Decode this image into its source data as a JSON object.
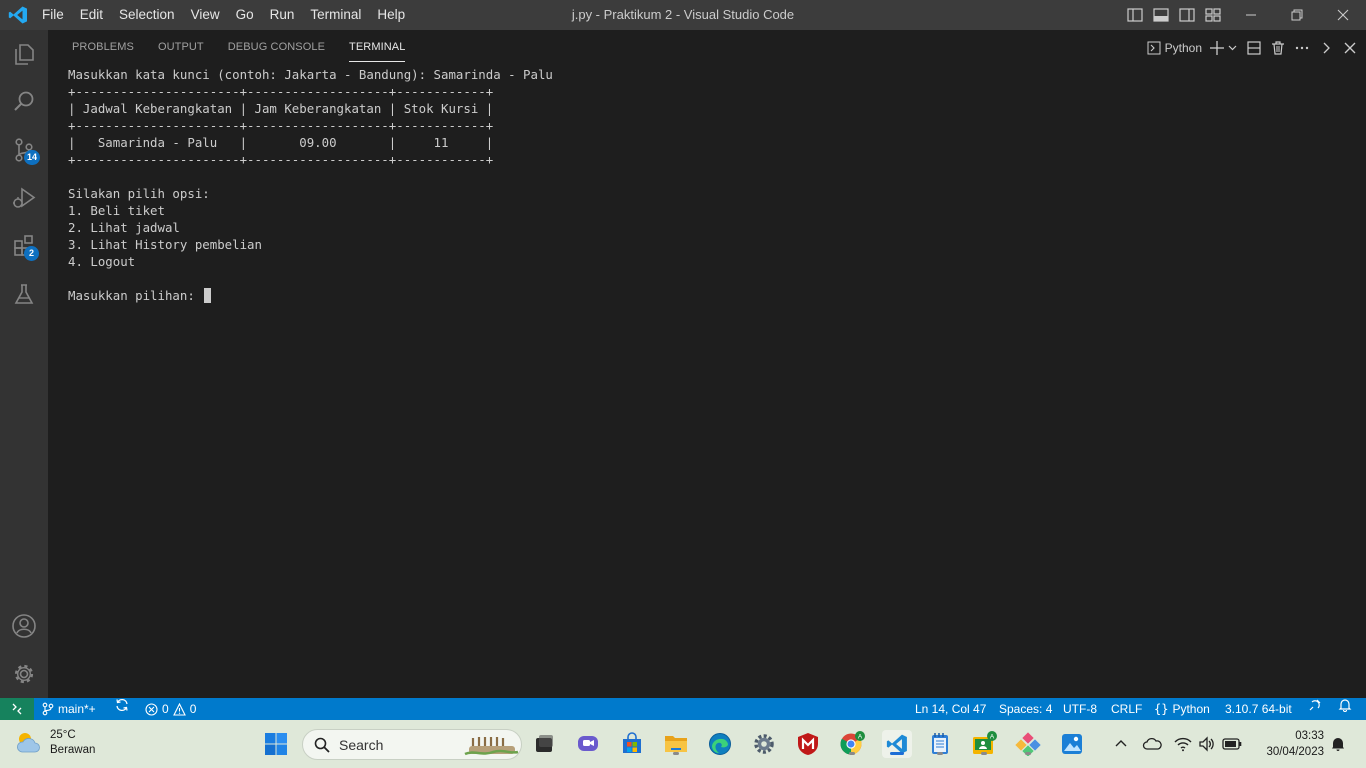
{
  "titlebar": {
    "menu": [
      "File",
      "Edit",
      "Selection",
      "View",
      "Go",
      "Run",
      "Terminal",
      "Help"
    ],
    "title": "j.py - Praktikum 2 - Visual Studio Code"
  },
  "activitybar": {
    "scm_badge": "14",
    "extensions_badge": "2"
  },
  "panel": {
    "tabs": [
      "PROBLEMS",
      "OUTPUT",
      "DEBUG CONSOLE",
      "TERMINAL"
    ],
    "active_tab": "TERMINAL",
    "terminal_name": "Python",
    "terminal_lines": [
      "Masukkan kata kunci (contoh: Jakarta - Bandung): Samarinda - Palu",
      "+----------------------+-------------------+------------+",
      "| Jadwal Keberangkatan | Jam Keberangkatan | Stok Kursi |",
      "+----------------------+-------------------+------------+",
      "|   Samarinda - Palu   |       09.00       |     11     |",
      "+----------------------+-------------------+------------+",
      "",
      "Silakan pilih opsi:",
      "1. Beli tiket",
      "2. Lihat jadwal",
      "3. Lihat History pembelian",
      "4. Logout",
      "",
      "Masukkan pilihan: "
    ]
  },
  "statusbar": {
    "branch": "main*+",
    "errors": "0",
    "warnings": "0",
    "position": "Ln 14, Col 47",
    "spaces": "Spaces: 4",
    "encoding": "UTF-8",
    "eol": "CRLF",
    "language": "Python",
    "interpreter": "3.10.7 64-bit"
  },
  "taskbar": {
    "temperature": "25°C",
    "weather": "Berawan",
    "search_placeholder": "Search",
    "time": "03:33",
    "date": "30/04/2023"
  }
}
